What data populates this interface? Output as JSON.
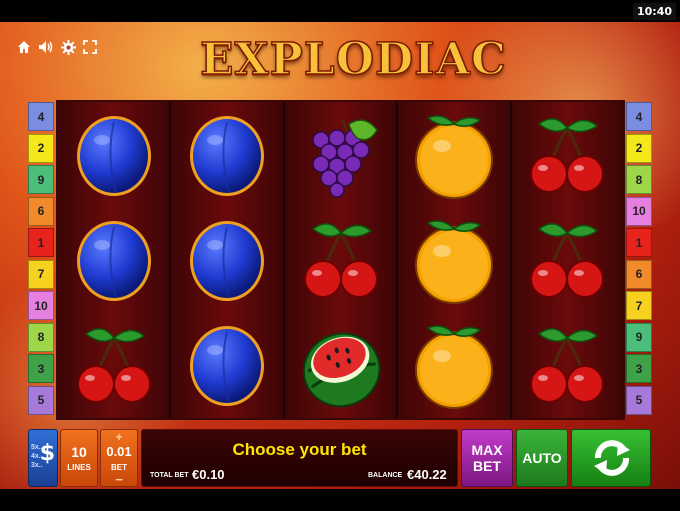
{
  "status_bar": {
    "time": "10:40"
  },
  "top_icons": [
    "home-icon",
    "speaker-icon",
    "gear-icon",
    "fullscreen-icon"
  ],
  "game": {
    "title": "EXPLODIAC"
  },
  "paylines": {
    "left": [
      "4",
      "2",
      "9",
      "6",
      "1",
      "7",
      "10",
      "8",
      "3",
      "5"
    ],
    "right": [
      "4",
      "2",
      "8",
      "10",
      "1",
      "6",
      "7",
      "9",
      "3",
      "5"
    ],
    "colors": {
      "1": "#e8231c",
      "2": "#f4e81a",
      "3": "#3fa148",
      "4": "#7a8de0",
      "5": "#a77ad9",
      "6": "#f08a2b",
      "7": "#f6d11f",
      "8": "#9ed64a",
      "9": "#4bbf79",
      "10": "#e57fe0"
    }
  },
  "reels": [
    [
      "plum",
      "plum",
      "cherries"
    ],
    [
      "plum",
      "plum",
      "plum"
    ],
    [
      "grapes",
      "cherries",
      "watermelon"
    ],
    [
      "orange",
      "orange",
      "orange"
    ],
    [
      "cherries",
      "cherries",
      "cherries"
    ]
  ],
  "controls": {
    "denom_rows": [
      "5x..",
      "4x..",
      "3x.."
    ],
    "denom_symbol": "$",
    "lines_value": "10",
    "lines_label": "LINES",
    "bet_plus": "+",
    "bet_value": "0.01",
    "bet_label": "BET",
    "bet_minus": "−",
    "message": "Choose your bet",
    "total_bet_label": "TOTAL BET",
    "total_bet_value": "€0.10",
    "balance_label": "BALANCE",
    "balance_value": "€40.22",
    "max_bet_line1": "MAX",
    "max_bet_line2": "BET",
    "auto_label": "AUTO",
    "spin_icon": "refresh-icon"
  }
}
